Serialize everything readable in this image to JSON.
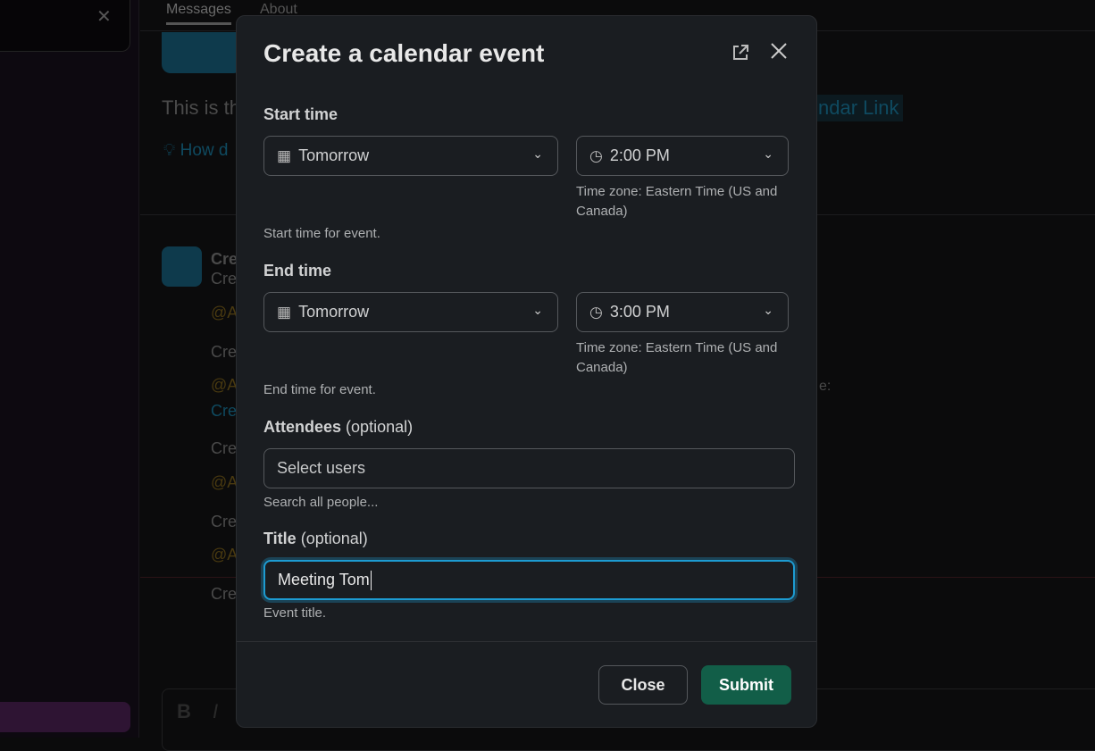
{
  "background": {
    "tabs": [
      "Messages",
      "About"
    ],
    "intro_text": "This is th",
    "help_link": "How d",
    "calendar_link": "ndar Link",
    "messages": [
      "Cre",
      "Cre",
      "@A",
      "Cre",
      "@A",
      "Cre",
      "Cre",
      "@A",
      "Cre",
      "@A",
      "Cre"
    ],
    "side_text": "e:",
    "composer": {
      "bold": "B",
      "italic": "I"
    }
  },
  "modal": {
    "title": "Create a calendar event",
    "start": {
      "label": "Start time",
      "date": "Tomorrow",
      "time": "2:00 PM",
      "timezone": "Time zone: Eastern Time (US and Canada)",
      "hint": "Start time for event."
    },
    "end": {
      "label": "End time",
      "date": "Tomorrow",
      "time": "3:00 PM",
      "timezone": "Time zone: Eastern Time (US and Canada)",
      "hint": "End time for event."
    },
    "attendees": {
      "label": "Attendees",
      "optional": "(optional)",
      "placeholder": "Select users",
      "hint": "Search all people..."
    },
    "title_field": {
      "label": "Title",
      "optional": "(optional)",
      "value": "Meeting Tom",
      "hint": "Event title."
    },
    "close_label": "Close",
    "submit_label": "Submit"
  },
  "colors": {
    "modal_bg": "#1a1d21",
    "submit": "#125e48",
    "focus": "#1d9bd1"
  }
}
